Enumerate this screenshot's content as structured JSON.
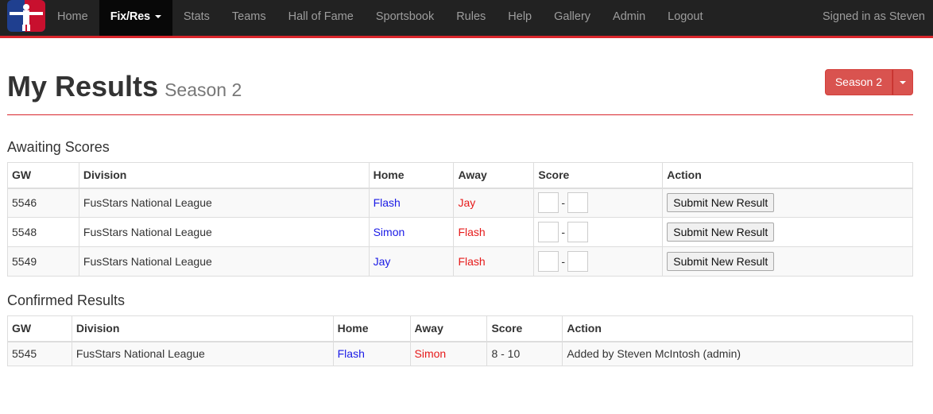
{
  "navbar": {
    "logo": "fusstars-logo",
    "items": [
      {
        "label": "Home",
        "active": false
      },
      {
        "label": "Fix/Res",
        "active": true,
        "dropdown": true
      },
      {
        "label": "Stats",
        "active": false
      },
      {
        "label": "Teams",
        "active": false
      },
      {
        "label": "Hall of Fame",
        "active": false
      },
      {
        "label": "Sportsbook",
        "active": false
      },
      {
        "label": "Rules",
        "active": false
      },
      {
        "label": "Help",
        "active": false
      },
      {
        "label": "Gallery",
        "active": false
      },
      {
        "label": "Admin",
        "active": false
      },
      {
        "label": "Logout",
        "active": false
      }
    ],
    "signed_in": "Signed in as Steven"
  },
  "page": {
    "title": "My Results",
    "subtitle": "Season 2",
    "season_button": "Season 2"
  },
  "awaiting": {
    "heading": "Awaiting Scores",
    "columns": [
      "GW",
      "Division",
      "Home",
      "Away",
      "Score",
      "Action"
    ],
    "rows": [
      {
        "gw": "5546",
        "division": "FusStars National League",
        "home": "Flash",
        "away": "Jay",
        "action": "Submit New Result"
      },
      {
        "gw": "5548",
        "division": "FusStars National League",
        "home": "Simon",
        "away": "Flash",
        "action": "Submit New Result"
      },
      {
        "gw": "5549",
        "division": "FusStars National League",
        "home": "Jay",
        "away": "Flash",
        "action": "Submit New Result"
      }
    ],
    "score_separator": "-"
  },
  "confirmed": {
    "heading": "Confirmed Results",
    "columns": [
      "GW",
      "Division",
      "Home",
      "Away",
      "Score",
      "Action"
    ],
    "rows": [
      {
        "gw": "5545",
        "division": "FusStars National League",
        "home": "Flash",
        "away": "Simon",
        "score": "8 - 10",
        "action": "Added by Steven McIntosh (admin)"
      }
    ]
  },
  "colors": {
    "accent": "#d9262c",
    "home": "#1a1ae6",
    "away": "#e61a1a",
    "season_button": "#d9534f"
  }
}
